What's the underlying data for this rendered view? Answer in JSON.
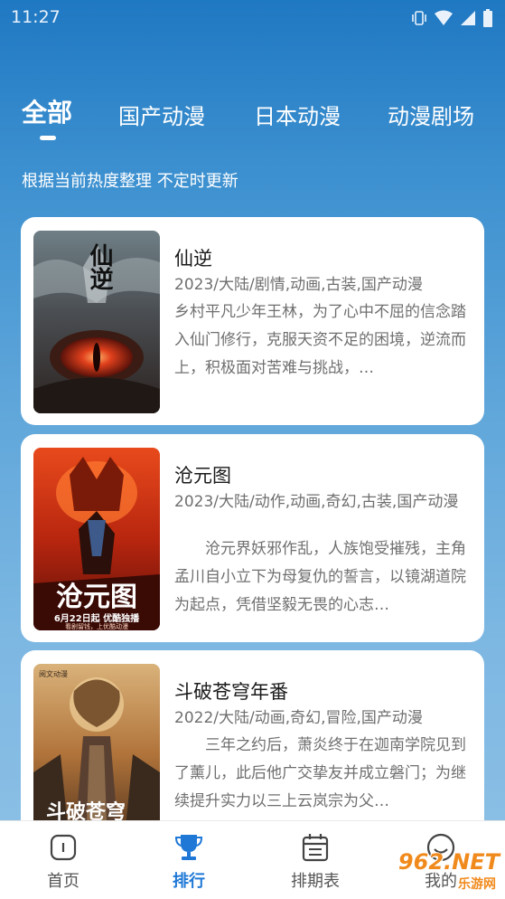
{
  "status_bar": {
    "time": "11:27"
  },
  "tabs": [
    {
      "label": "全部"
    },
    {
      "label": "国产动漫"
    },
    {
      "label": "日本动漫"
    },
    {
      "label": "动漫剧场"
    }
  ],
  "subtitle": "根据当前热度整理 不定时更新",
  "items": [
    {
      "title": "仙逆",
      "meta": "2023/大陆/剧情,动画,古装,国产动漫",
      "desc": "乡村平凡少年王林，为了心中不屈的信念踏入仙门修行，克服天资不足的困境，逆流而上，积极面对苦难与挑战，…",
      "poster_text": "仙逆"
    },
    {
      "title": "沧元图",
      "meta": "2023/大陆/动作,动画,奇幻,古装,国产动漫",
      "desc": "　　沧元界妖邪作乱，人族饱受摧残，主角孟川自小立下为母复仇的誓言，以镜湖道院为起点，凭借坚毅无畏的心志…",
      "poster_text": "沧元图",
      "poster_caption": "6月22日起 优酷独播",
      "poster_caption2": "看剧留钱，上优酷动漫"
    },
    {
      "title": "斗破苍穹年番",
      "meta": "2022/大陆/动画,奇幻,冒险,国产动漫",
      "desc": "　　三年之约后，萧炎终于在迦南学院见到了薰儿，此后他广交挚友并成立磐门；为继续提升实力以三上云岚宗为父…",
      "poster_text": "斗破苍穹",
      "poster_top_text": "阅文动漫"
    }
  ],
  "bottom_nav": [
    {
      "label": "首页"
    },
    {
      "label": "排行"
    },
    {
      "label": "排期表"
    },
    {
      "label": "我的"
    }
  ],
  "watermark": {
    "brand": "962.NET",
    "sub": "乐游网"
  },
  "colors": {
    "accent": "#1f78d6",
    "header_bg_top": "#1f78c2",
    "header_bg_bottom": "#8fc1e6"
  }
}
